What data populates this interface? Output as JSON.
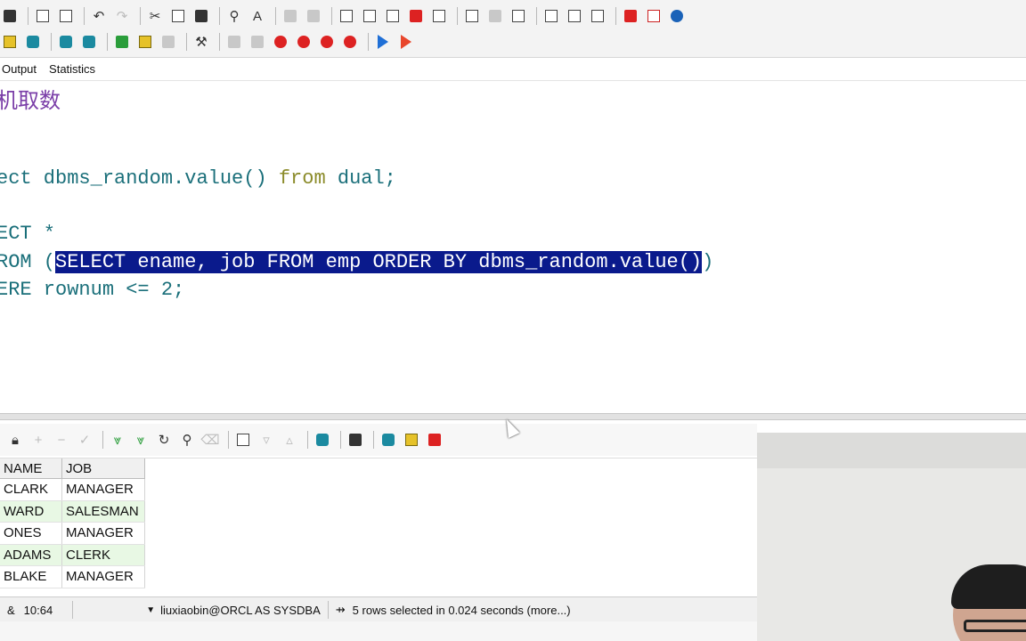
{
  "toolbar": {
    "row1_icons": [
      "print-icon",
      "print-preview-icon",
      "undo-icon",
      "redo-icon",
      "cut-icon",
      "copy-icon",
      "paste-icon",
      "find-icon",
      "find-next-icon",
      "indent-icon",
      "unindent-icon",
      "uppercase-icon",
      "lowercase-icon",
      "comment-icon",
      "uncomment-icon",
      "window-list-icon",
      "tile-icon",
      "cascade-icon",
      "oracle-icon",
      "pdf-icon",
      "info-icon"
    ],
    "row2_icons": [
      "session-icon",
      "sql-icon",
      "execute-icon",
      "debug-icon",
      "explain-icon",
      "tools-icon",
      "settings-icon",
      "wrench-icon",
      "break-icon",
      "clear-icon",
      "commit-icon",
      "rollback-icon",
      "trace-icon",
      "forward-arrow-icon",
      "back-arrow-icon"
    ]
  },
  "tabs": [
    {
      "label": "Output"
    },
    {
      "label": "Statistics"
    }
  ],
  "editor": {
    "comment": "机取数",
    "line1": {
      "kw": "ect",
      "body": " dbms_random.value() ",
      "kw2": "from",
      "tail": " dual;"
    },
    "line2": "ECT *",
    "line3": {
      "pre": "ROM (",
      "selected": "SELECT ename, job FROM emp ORDER BY dbms_random.value()",
      "post": ")"
    },
    "line4": "ERE rownum <= 2;"
  },
  "grid": {
    "columns": [
      "NAME",
      "JOB"
    ],
    "rows": [
      {
        "ename": "CLARK",
        "job": "MANAGER"
      },
      {
        "ename": "WARD",
        "job": "SALESMAN"
      },
      {
        "ename": "ONES",
        "job": "MANAGER"
      },
      {
        "ename": "ADAMS",
        "job": "CLERK"
      },
      {
        "ename": "BLAKE",
        "job": "MANAGER"
      }
    ]
  },
  "status": {
    "position": "10:64",
    "connection": "liuxiaobin@ORCL AS SYSDBA",
    "message": "5 rows selected in 0.024 seconds (more...)"
  },
  "colors": {
    "selection": "#0a1a8c",
    "keyword": "#1a6f7a",
    "comment": "#7b3fa8",
    "alt_row": "#e8f8e4"
  }
}
